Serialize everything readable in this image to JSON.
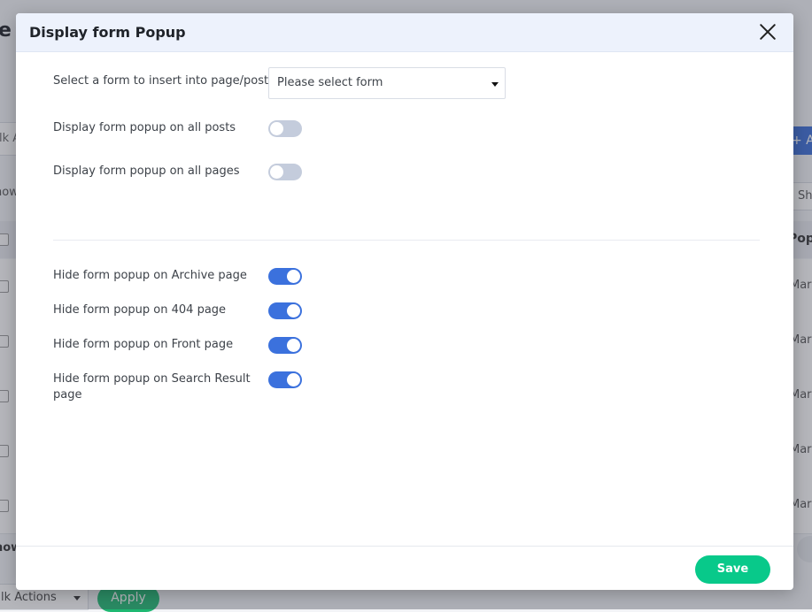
{
  "background": {
    "title_fragment": "e",
    "bulk_actions_top": "lk A",
    "add_button_fragment": "+ Ad",
    "show_left_fragment": "how",
    "show_right_fragment": "Sh",
    "column_fragment": "Pop",
    "row_dates": [
      "Mar",
      "Mar",
      "Mar",
      "Mar",
      "Mar"
    ],
    "show_bottom_fragment": "how",
    "bulk_actions_bottom": "lk Actions",
    "apply_label": "Apply"
  },
  "modal": {
    "title": "Display form Popup",
    "form_select": {
      "label": "Select a form to insert into page/post:",
      "value": "Please select form"
    },
    "display_toggles": [
      {
        "label": "Display form popup on all posts",
        "enabled": false
      },
      {
        "label": "Display form popup on all pages",
        "enabled": false
      }
    ],
    "hide_toggles": [
      {
        "label": "Hide form popup on Archive page",
        "enabled": true
      },
      {
        "label": "Hide form popup on 404 page",
        "enabled": true
      },
      {
        "label": "Hide form popup on Front page",
        "enabled": true
      },
      {
        "label": "Hide form popup on Search Result page",
        "enabled": true
      }
    ],
    "save_label": "Save"
  },
  "colors": {
    "toggle_on": "#3b71dd",
    "toggle_off": "#c4ccdc",
    "save_button": "#08c98a",
    "header_bg": "#edf2fc"
  }
}
